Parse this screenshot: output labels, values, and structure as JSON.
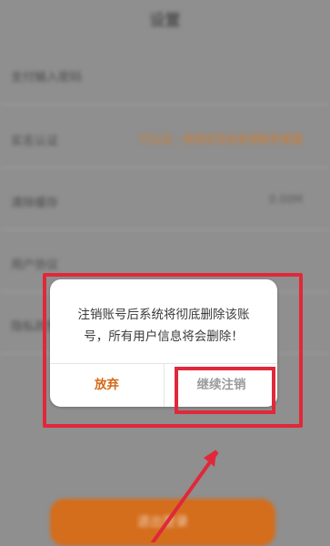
{
  "background": {
    "title": "设置",
    "rows": [
      {
        "label": "支付输入密码",
        "value": ""
      },
      {
        "label": "实名认证",
        "value": "已认证 · 修改实名信息请联系客服",
        "accent": "orange"
      },
      {
        "label": "清除缓存",
        "value": "0.00M"
      },
      {
        "label": "用户协议",
        "value": ""
      },
      {
        "label": "隐私政策",
        "value": ""
      }
    ],
    "button_label": "退出登录"
  },
  "dialog": {
    "message_line1": "注销账号后系统将彻底删除该账",
    "message_line2": "号，所有用户信息将会删除！",
    "cancel_label": "放弃",
    "confirm_label": "继续注销"
  },
  "colors": {
    "accent": "#d46a16",
    "highlight": "#e0283a"
  }
}
